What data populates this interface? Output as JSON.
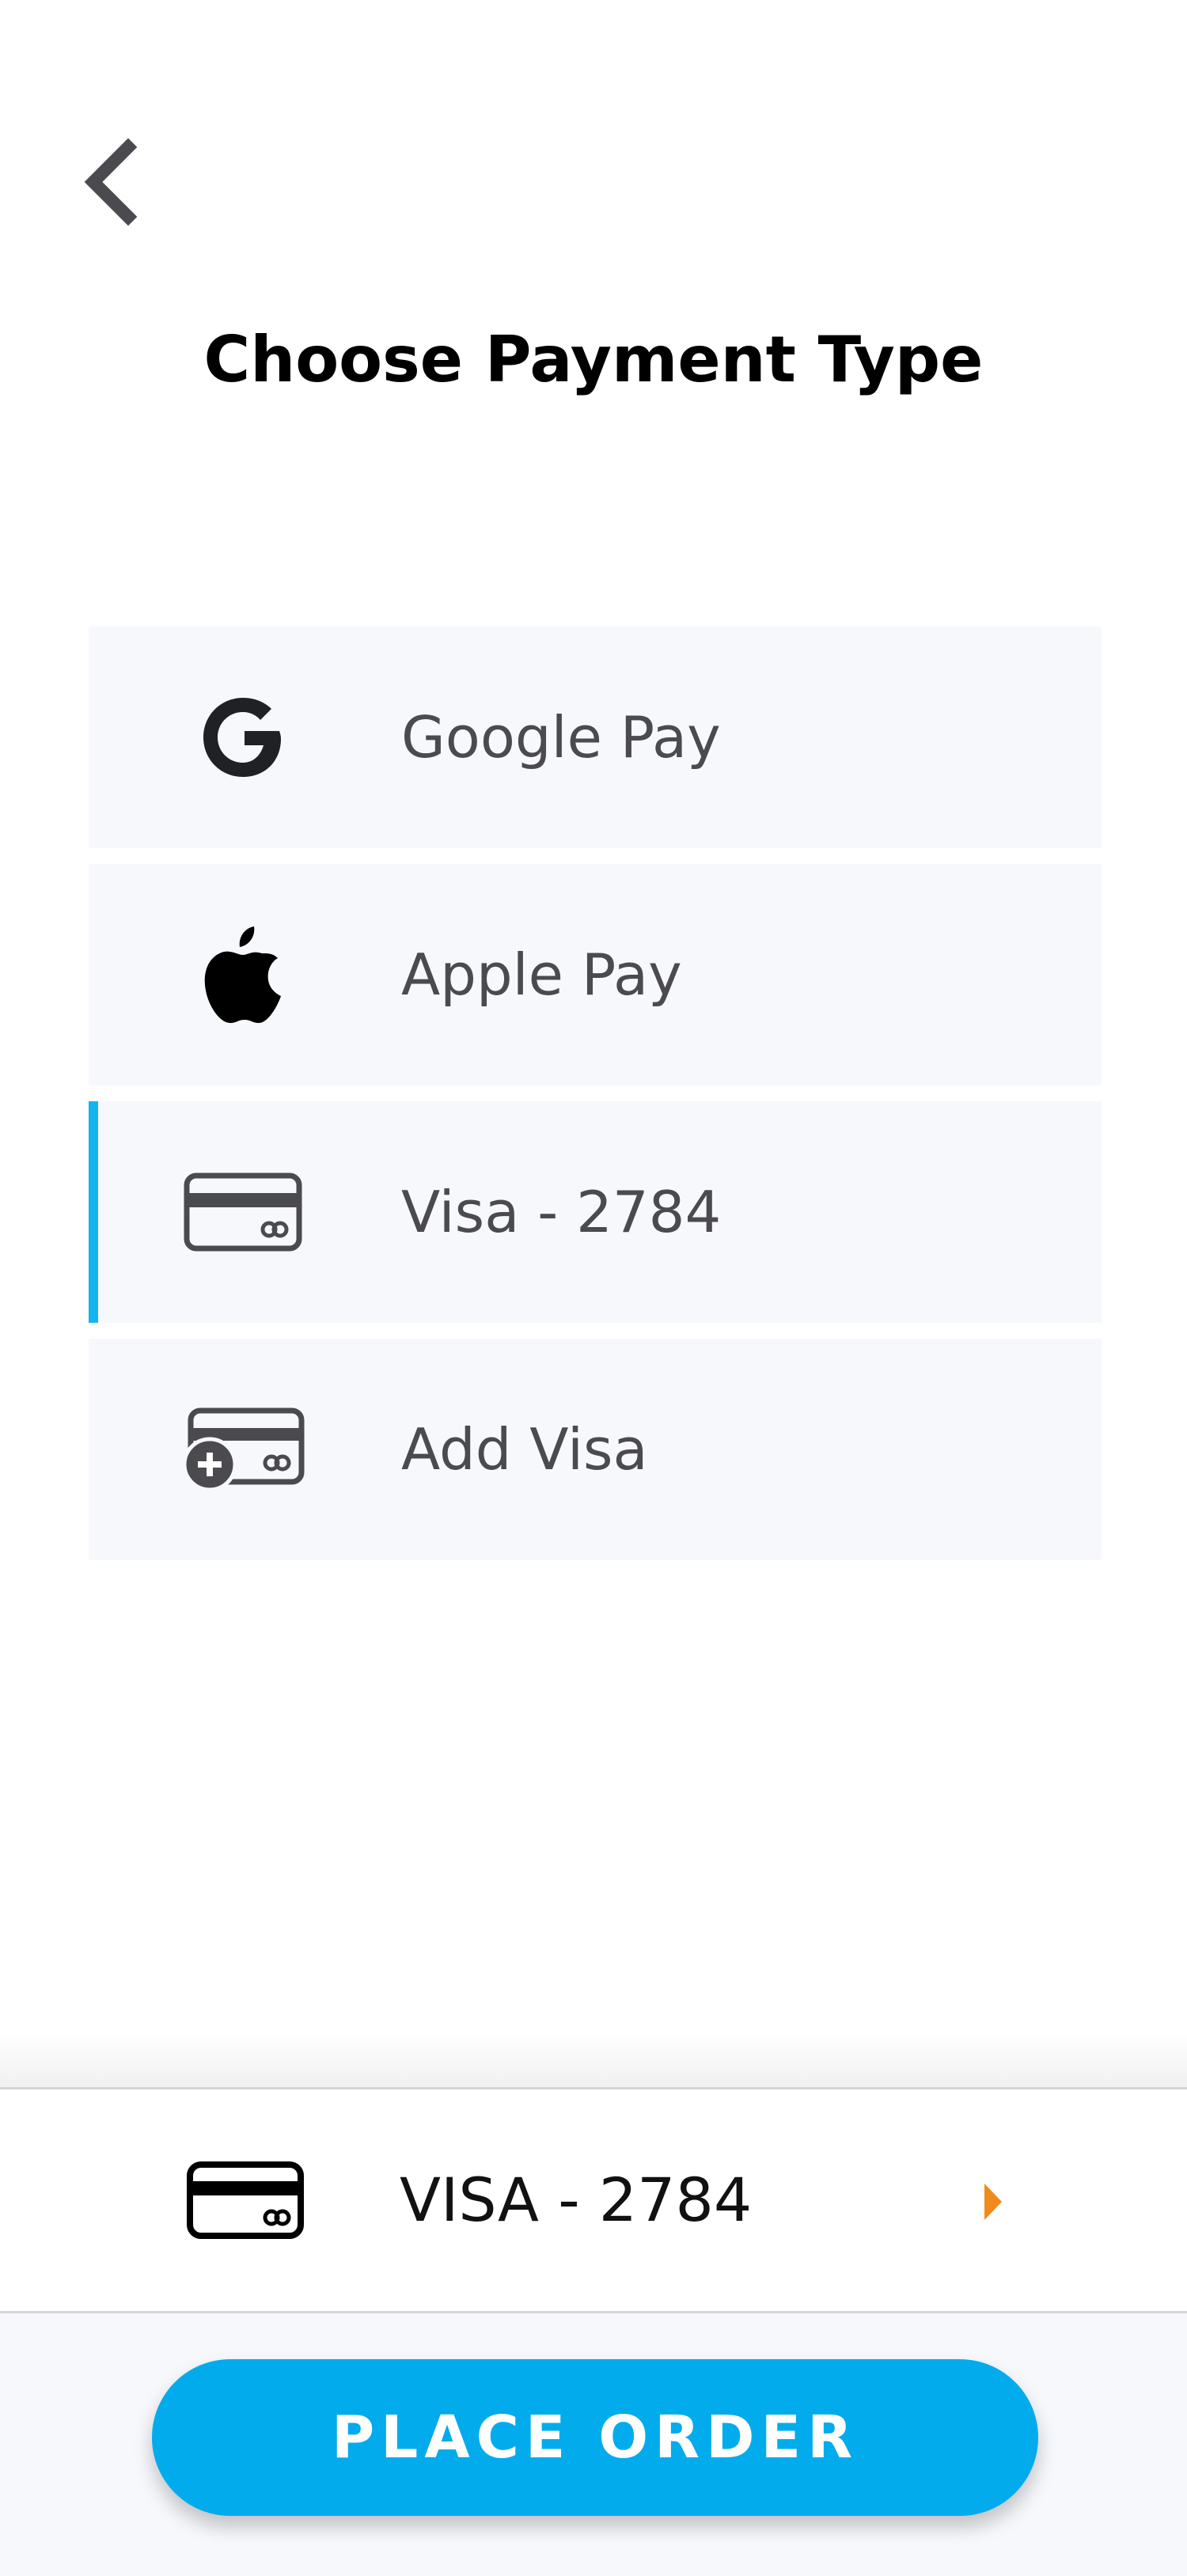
{
  "header": {
    "back_icon": "chevron-left-icon",
    "title": "Choose Payment Type"
  },
  "payment_options": [
    {
      "label": "Google Pay",
      "icon": "google-icon",
      "selected": false
    },
    {
      "label": "Apple Pay",
      "icon": "apple-icon",
      "selected": false
    },
    {
      "label": "Visa - 2784",
      "icon": "credit-card-icon",
      "selected": true
    },
    {
      "label": "Add Visa",
      "icon": "add-card-icon",
      "selected": false
    }
  ],
  "summary": {
    "label": "VISA - 2784",
    "icon": "credit-card-icon",
    "chevron_icon": "caret-right-icon"
  },
  "actions": {
    "place_order_label": "PLACE ORDER"
  },
  "colors": {
    "accent": "#02acec",
    "selected_bar": "#14b4ee",
    "chevron": "#f08a1c",
    "row_background": "#f7f8fc",
    "icon_gray": "#4a4a4f"
  }
}
